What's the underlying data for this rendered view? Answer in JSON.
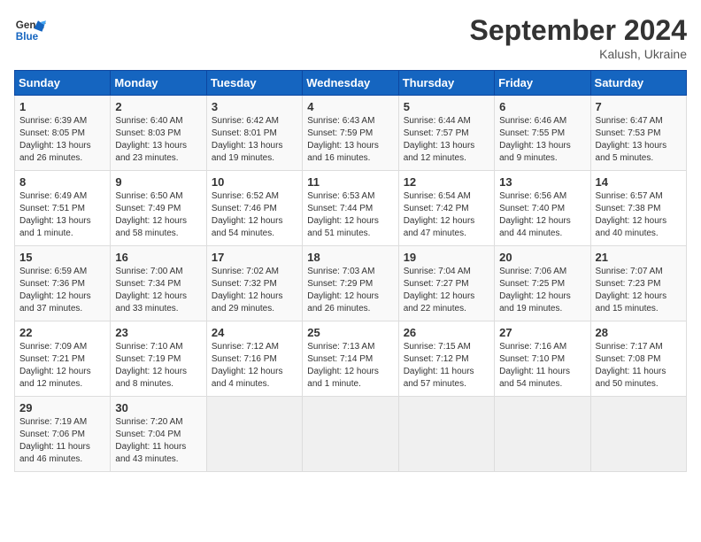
{
  "header": {
    "logo_line1": "General",
    "logo_line2": "Blue",
    "month_title": "September 2024",
    "location": "Kalush, Ukraine"
  },
  "weekdays": [
    "Sunday",
    "Monday",
    "Tuesday",
    "Wednesday",
    "Thursday",
    "Friday",
    "Saturday"
  ],
  "weeks": [
    [
      {
        "day": "1",
        "sunrise": "6:39 AM",
        "sunset": "8:05 PM",
        "daylight": "13 hours and 26 minutes."
      },
      {
        "day": "2",
        "sunrise": "6:40 AM",
        "sunset": "8:03 PM",
        "daylight": "13 hours and 23 minutes."
      },
      {
        "day": "3",
        "sunrise": "6:42 AM",
        "sunset": "8:01 PM",
        "daylight": "13 hours and 19 minutes."
      },
      {
        "day": "4",
        "sunrise": "6:43 AM",
        "sunset": "7:59 PM",
        "daylight": "13 hours and 16 minutes."
      },
      {
        "day": "5",
        "sunrise": "6:44 AM",
        "sunset": "7:57 PM",
        "daylight": "13 hours and 12 minutes."
      },
      {
        "day": "6",
        "sunrise": "6:46 AM",
        "sunset": "7:55 PM",
        "daylight": "13 hours and 9 minutes."
      },
      {
        "day": "7",
        "sunrise": "6:47 AM",
        "sunset": "7:53 PM",
        "daylight": "13 hours and 5 minutes."
      }
    ],
    [
      {
        "day": "8",
        "sunrise": "6:49 AM",
        "sunset": "7:51 PM",
        "daylight": "13 hours and 1 minute."
      },
      {
        "day": "9",
        "sunrise": "6:50 AM",
        "sunset": "7:49 PM",
        "daylight": "12 hours and 58 minutes."
      },
      {
        "day": "10",
        "sunrise": "6:52 AM",
        "sunset": "7:46 PM",
        "daylight": "12 hours and 54 minutes."
      },
      {
        "day": "11",
        "sunrise": "6:53 AM",
        "sunset": "7:44 PM",
        "daylight": "12 hours and 51 minutes."
      },
      {
        "day": "12",
        "sunrise": "6:54 AM",
        "sunset": "7:42 PM",
        "daylight": "12 hours and 47 minutes."
      },
      {
        "day": "13",
        "sunrise": "6:56 AM",
        "sunset": "7:40 PM",
        "daylight": "12 hours and 44 minutes."
      },
      {
        "day": "14",
        "sunrise": "6:57 AM",
        "sunset": "7:38 PM",
        "daylight": "12 hours and 40 minutes."
      }
    ],
    [
      {
        "day": "15",
        "sunrise": "6:59 AM",
        "sunset": "7:36 PM",
        "daylight": "12 hours and 37 minutes."
      },
      {
        "day": "16",
        "sunrise": "7:00 AM",
        "sunset": "7:34 PM",
        "daylight": "12 hours and 33 minutes."
      },
      {
        "day": "17",
        "sunrise": "7:02 AM",
        "sunset": "7:32 PM",
        "daylight": "12 hours and 29 minutes."
      },
      {
        "day": "18",
        "sunrise": "7:03 AM",
        "sunset": "7:29 PM",
        "daylight": "12 hours and 26 minutes."
      },
      {
        "day": "19",
        "sunrise": "7:04 AM",
        "sunset": "7:27 PM",
        "daylight": "12 hours and 22 minutes."
      },
      {
        "day": "20",
        "sunrise": "7:06 AM",
        "sunset": "7:25 PM",
        "daylight": "12 hours and 19 minutes."
      },
      {
        "day": "21",
        "sunrise": "7:07 AM",
        "sunset": "7:23 PM",
        "daylight": "12 hours and 15 minutes."
      }
    ],
    [
      {
        "day": "22",
        "sunrise": "7:09 AM",
        "sunset": "7:21 PM",
        "daylight": "12 hours and 12 minutes."
      },
      {
        "day": "23",
        "sunrise": "7:10 AM",
        "sunset": "7:19 PM",
        "daylight": "12 hours and 8 minutes."
      },
      {
        "day": "24",
        "sunrise": "7:12 AM",
        "sunset": "7:16 PM",
        "daylight": "12 hours and 4 minutes."
      },
      {
        "day": "25",
        "sunrise": "7:13 AM",
        "sunset": "7:14 PM",
        "daylight": "12 hours and 1 minute."
      },
      {
        "day": "26",
        "sunrise": "7:15 AM",
        "sunset": "7:12 PM",
        "daylight": "11 hours and 57 minutes."
      },
      {
        "day": "27",
        "sunrise": "7:16 AM",
        "sunset": "7:10 PM",
        "daylight": "11 hours and 54 minutes."
      },
      {
        "day": "28",
        "sunrise": "7:17 AM",
        "sunset": "7:08 PM",
        "daylight": "11 hours and 50 minutes."
      }
    ],
    [
      {
        "day": "29",
        "sunrise": "7:19 AM",
        "sunset": "7:06 PM",
        "daylight": "11 hours and 46 minutes."
      },
      {
        "day": "30",
        "sunrise": "7:20 AM",
        "sunset": "7:04 PM",
        "daylight": "11 hours and 43 minutes."
      },
      null,
      null,
      null,
      null,
      null
    ]
  ]
}
